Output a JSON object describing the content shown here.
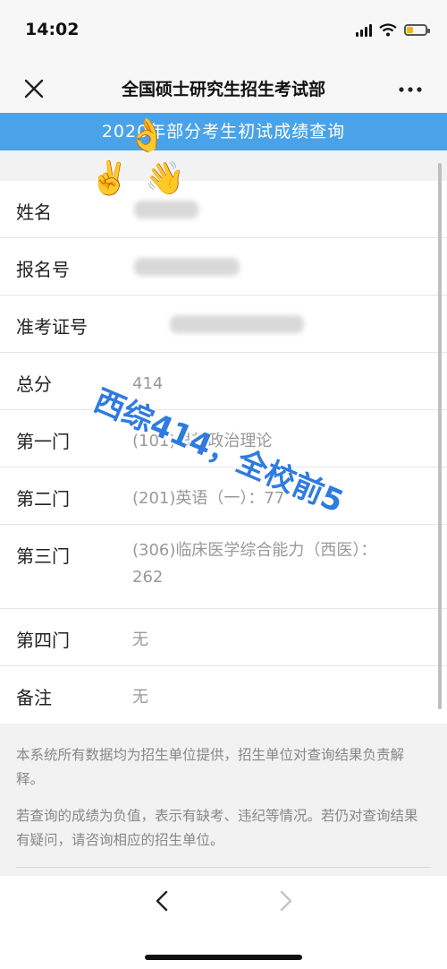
{
  "status": {
    "time": "14:02"
  },
  "nav": {
    "title": "全国硕士研究生招生考试部"
  },
  "banner": {
    "text": "2020年部分考生初试成绩查询"
  },
  "rows": [
    {
      "label": "姓名",
      "value": ""
    },
    {
      "label": "报名号",
      "value": ""
    },
    {
      "label": "准考证号",
      "value": ""
    },
    {
      "label": "总分",
      "value": "414"
    },
    {
      "label": "第一门",
      "value": "(101)思想政治理论"
    },
    {
      "label": "第二门",
      "value": "(201)英语（一）：77"
    },
    {
      "label": "第三门",
      "value": "(306)临床医学综合能力（西医）：262"
    },
    {
      "label": "第四门",
      "value": "无"
    },
    {
      "label": "备注",
      "value": "无"
    }
  ],
  "overlay_text": "西综414，全校前5",
  "emojis": {
    "top": "👌",
    "left": "✌️",
    "right": "👋"
  },
  "disclaimer": {
    "p1": "本系统所有数据均为招生单位提供，招生单位对查询结果负责解释。",
    "p2": "若查询的成绩为负值，表示有缺考、违纪等情况。若仍对查询结果有疑问，请咨询相应的招生单位。"
  },
  "icons": {
    "close": "close-icon",
    "more": "more-icon",
    "back": "chevron-left-icon",
    "forward": "chevron-right-icon",
    "signal": "signal-icon",
    "wifi": "wifi-icon",
    "battery": "battery-icon"
  },
  "colors": {
    "banner": "#4aa3e8",
    "overlay_text": "#2f7be0",
    "battery": "#f2b705"
  }
}
